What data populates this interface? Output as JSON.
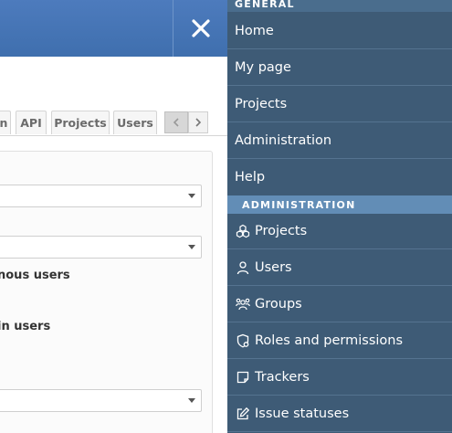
{
  "tabs": [
    "n",
    "API",
    "Projects",
    "Users"
  ],
  "form_labels": [
    "nous users",
    "in users"
  ],
  "menu": {
    "general_header": "GENERAL",
    "general_items": [
      {
        "label": "Home"
      },
      {
        "label": "My page"
      },
      {
        "label": "Projects"
      },
      {
        "label": "Administration"
      },
      {
        "label": "Help"
      }
    ],
    "admin_header": "ADMINISTRATION",
    "admin_items": [
      {
        "label": "Projects",
        "icon": "projects-icon"
      },
      {
        "label": "Users",
        "icon": "user-icon"
      },
      {
        "label": "Groups",
        "icon": "groups-icon"
      },
      {
        "label": "Roles and permissions",
        "icon": "shield-icon"
      },
      {
        "label": "Trackers",
        "icon": "tracker-icon"
      },
      {
        "label": "Issue statuses",
        "icon": "edit-icon"
      }
    ]
  },
  "colors": {
    "header_blue": "#3f6fae",
    "menu_background": "#3e5b76",
    "admin_header_background": "#628db6"
  }
}
